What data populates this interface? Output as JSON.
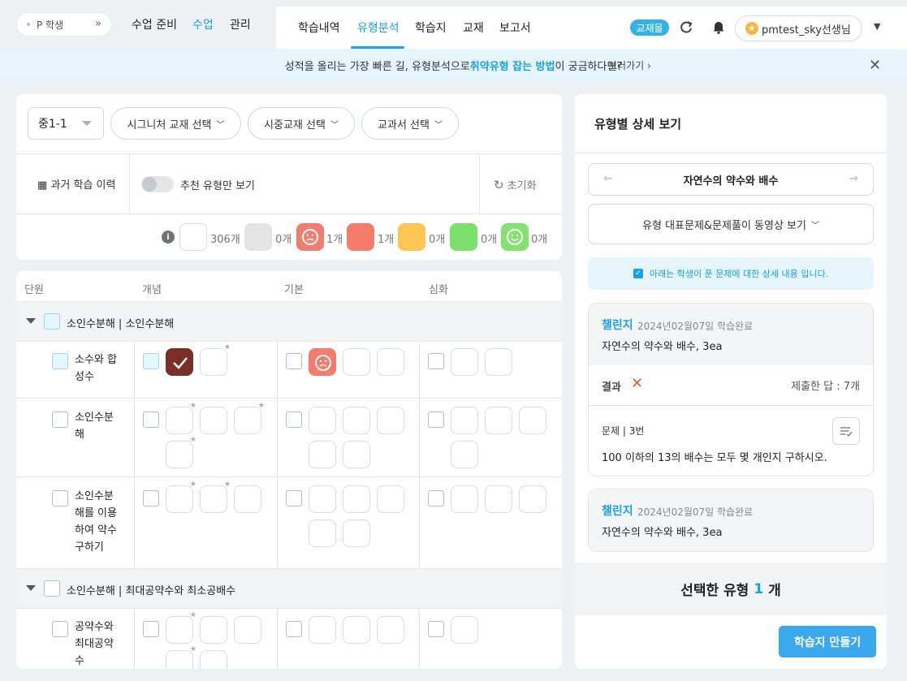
{
  "topnav": {
    "student": "P 학생",
    "student_toggle": "»",
    "main_tabs": [
      {
        "label": "수업 준비",
        "active": false
      },
      {
        "label": "수업",
        "active": true
      },
      {
        "label": "관리",
        "active": false
      }
    ],
    "sub_tabs": [
      {
        "label": "학습내역",
        "active": false
      },
      {
        "label": "유형분석",
        "active": true
      },
      {
        "label": "학습지",
        "active": false
      },
      {
        "label": "교재",
        "active": false
      },
      {
        "label": "보고서",
        "active": false
      }
    ],
    "badge": "교재몰",
    "user": "pmtest_sky선생님",
    "accent": "#1aa0e8"
  },
  "banner": {
    "text_before": "성적을 올리는 가장 빠른 길, 유형분석으로 ",
    "highlight": "취약유형 잡는 방법",
    "text_after": "이 궁금하다면?",
    "link": "보러가기 ›",
    "close": "✕"
  },
  "filters": {
    "grade": "중1-1",
    "signature": "시그니처 교재 선택",
    "market": "시중교재 선택",
    "textbook": "교과서 선택",
    "history": "과거 학습 이력",
    "toggle_label": "추천 유형만 보기",
    "toggle_on": false,
    "reset": "초기화"
  },
  "legend": [
    {
      "label": "306개",
      "color": "#ffffff",
      "face": ""
    },
    {
      "label": "0개",
      "color": "#e4e4e4",
      "face": ""
    },
    {
      "label": "1개",
      "color": "#f37c6c",
      "face": "☹"
    },
    {
      "label": "1개",
      "color": "#f37c6c",
      "face": ""
    },
    {
      "label": "0개",
      "color": "#fdc553",
      "face": ""
    },
    {
      "label": "0개",
      "color": "#7de06a",
      "face": ""
    },
    {
      "label": "0개",
      "color": "#82e36e",
      "face": "☺"
    }
  ],
  "table": {
    "headers": [
      "단원",
      "개념",
      "기본",
      "심화"
    ],
    "sections": [
      {
        "label": "소인수분해 | 소인수분해"
      },
      {
        "label": "소인수분해 | 최대공약수와 최소공배수"
      }
    ],
    "units": [
      {
        "lines": [
          "소수와 합",
          "성수"
        ]
      },
      {
        "lines": [
          "소인수분",
          "해"
        ]
      },
      {
        "lines": [
          "소인수분",
          "해를 이용",
          "하여 약수",
          "구하기"
        ]
      },
      {
        "lines": [
          "공약수와",
          "최대공약",
          "수"
        ]
      }
    ]
  },
  "detail": {
    "title": "유형별 상세 보기",
    "type_name": "자연수의 약수와 배수",
    "video": "유형 대표문제&문제풀이 동영상 보기",
    "note": "아래는 학생이 푼 문제에 대한 상세 내용 입니다.",
    "cards": [
      {
        "kind": "챌린지",
        "date": "2024년02월07일 학습완료",
        "subject": "자연수의 약수와 배수, 3ea",
        "result_label": "결과",
        "result_mark": "✕",
        "answers": "제출한 답 : 7개",
        "question_no": "문제 | 3번",
        "question": "100 이하의 13의 배수는 모두 몇 개인지 구하시오."
      },
      {
        "kind": "챌린지",
        "date": "2024년02월07일 학습완료",
        "subject": "자연수의 약수와 배수, 3ea"
      }
    ],
    "selected_prefix": "선택한 유형",
    "selected_count": "1",
    "selected_suffix": "개",
    "make_button": "학습지 만들기"
  }
}
